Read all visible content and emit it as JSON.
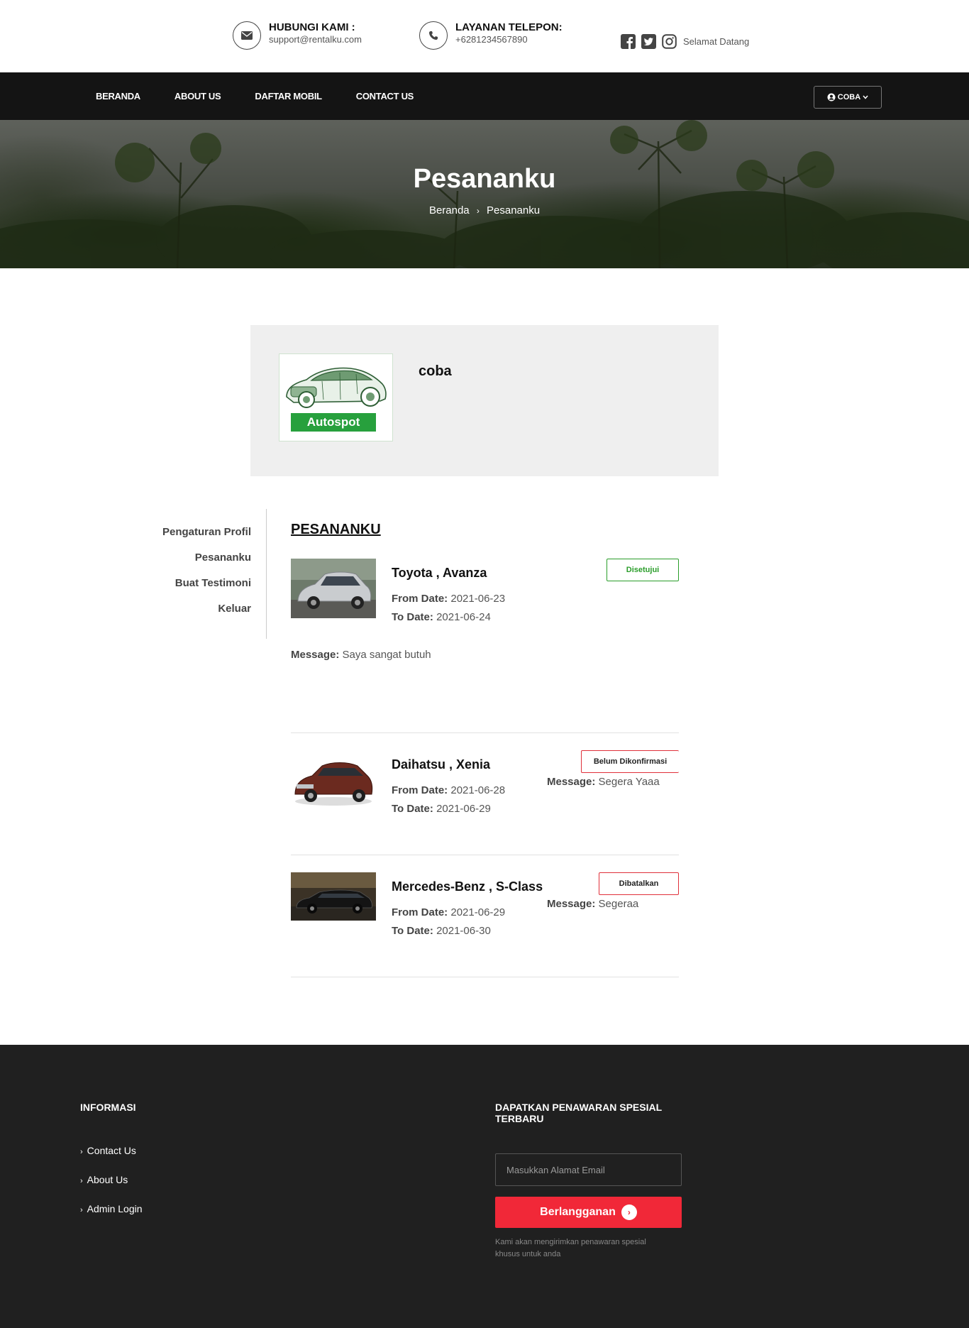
{
  "topbar": {
    "contact_email": {
      "title": "HUBUNGI KAMI :",
      "value": "support@rentalku.com",
      "icon": "envelope-icon"
    },
    "contact_phone": {
      "title": "LAYANAN TELEPON:",
      "value": "+6281234567890",
      "icon": "phone-icon"
    },
    "social": [
      "facebook-icon",
      "twitter-icon",
      "instagram-icon"
    ],
    "welcome": "Selamat Datang"
  },
  "nav": {
    "items": [
      "BERANDA",
      "ABOUT US",
      "DAFTAR MOBIL",
      "CONTACT US"
    ],
    "user_label": "COBA"
  },
  "hero": {
    "title": "Pesananku",
    "breadcrumb": [
      "Beranda",
      "Pesananku"
    ]
  },
  "profile": {
    "logo_text": "Autospot",
    "username": "coba"
  },
  "side_menu": [
    "Pengaturan Profil",
    "Pesananku",
    "Buat Testimoni",
    "Keluar"
  ],
  "bookings": {
    "heading": "PESANANKU",
    "from_label": "From Date:",
    "to_label": "To Date:",
    "message_label": "Message:",
    "items": [
      {
        "car": "Toyota , Avanza",
        "from": "2021-06-23",
        "to": "2021-06-24",
        "status": "Disetujui",
        "status_color": "#2a9d2a",
        "message": "Saya sangat butuh"
      },
      {
        "car": "Daihatsu , Xenia",
        "from": "2021-06-28",
        "to": "2021-06-29",
        "status": "Belum Dikonfirmasi",
        "status_color": "#e0303a",
        "message": "Segera Yaaa"
      },
      {
        "car": "Mercedes-Benz , S-Class",
        "from": "2021-06-29",
        "to": "2021-06-30",
        "status": "Dibatalkan",
        "status_color": "#e0303a",
        "message": "Segeraa"
      }
    ]
  },
  "footer": {
    "info_title": "INFORMASI",
    "links": [
      "Contact Us",
      "About Us",
      "Admin Login"
    ],
    "newsletter_title": "DAPATKAN PENAWARAN SPESIAL TERBARU",
    "email_placeholder": "Masukkan Alamat Email",
    "subscribe_label": "Berlangganan",
    "note": "Kami akan mengirimkan penawaran spesial khusus untuk anda"
  }
}
